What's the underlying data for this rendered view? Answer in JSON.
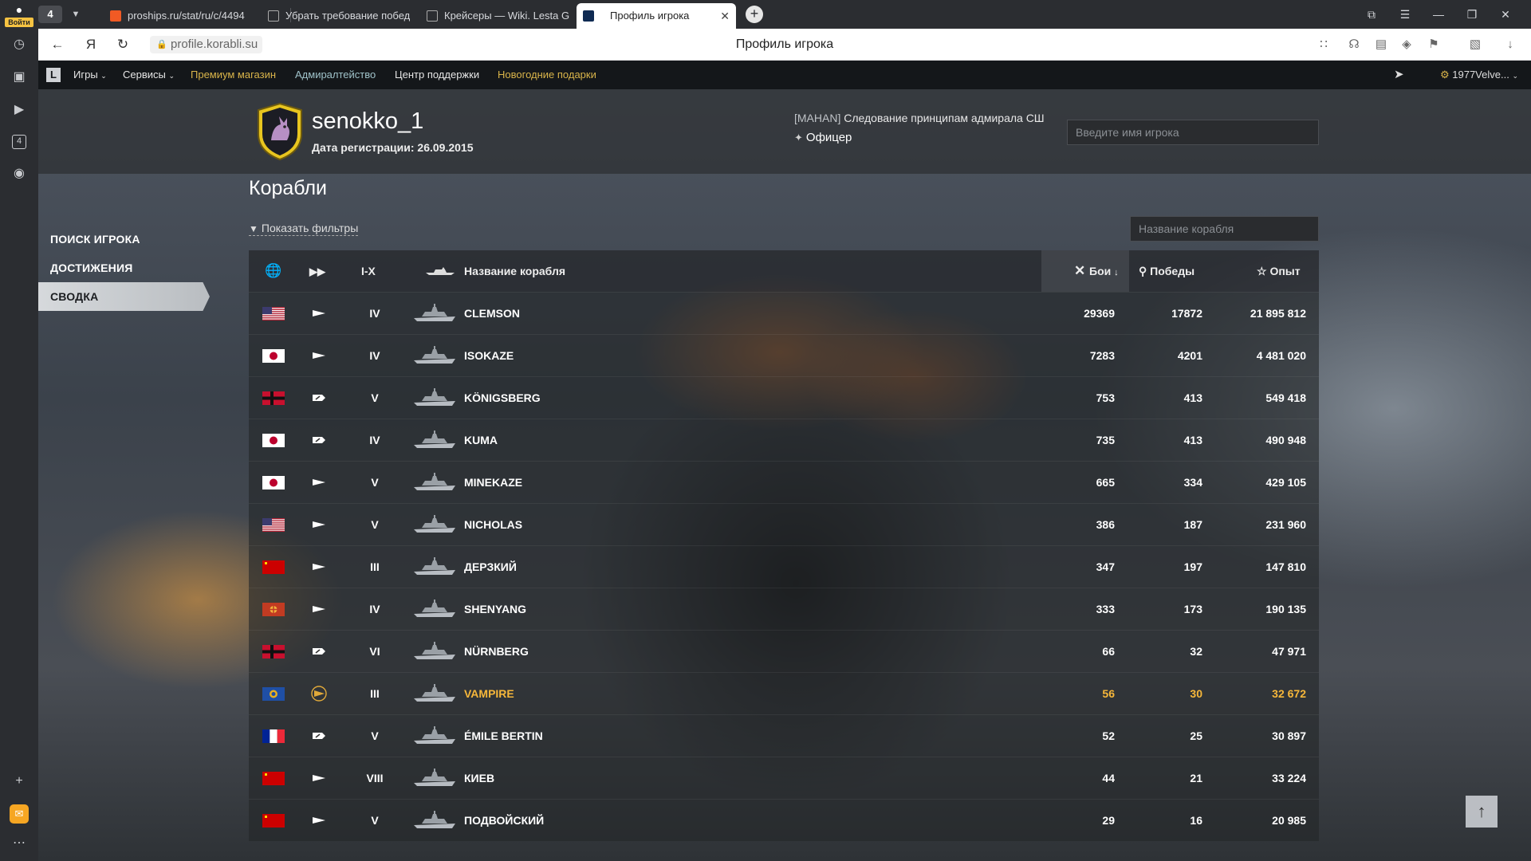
{
  "rail": {
    "login_label": "Войти",
    "tab_counter": "4"
  },
  "tabs": {
    "count": "4",
    "items": [
      {
        "title": "proships.ru/stat/ru/c/4494",
        "color": "#f15a24"
      },
      {
        "title": "Убрать требование побед",
        "color": "#3b3b3b"
      },
      {
        "title": "Крейсеры — Wiki. Lesta G",
        "color": "#3b3b3b"
      },
      {
        "title": "Профиль игрока",
        "color": "#0f2a52"
      }
    ]
  },
  "address": {
    "url": "profile.korabli.su",
    "page_title": "Профиль игрока"
  },
  "sitenav": {
    "logo": "L",
    "items": [
      {
        "label": "Игры",
        "color": "#e6e6e6",
        "dropdown": true
      },
      {
        "label": "Сервисы",
        "color": "#e6e6e6",
        "dropdown": true
      },
      {
        "label": "Премиум магазин",
        "color": "#d9b44a"
      },
      {
        "label": "Адмиралтейство",
        "color": "#9fc2c9"
      },
      {
        "label": "Центр поддержки",
        "color": "#e6e6e6"
      },
      {
        "label": "Новогодние подарки",
        "color": "#d9b44a"
      }
    ],
    "user": "1977Velve..."
  },
  "profile": {
    "name": "senokko_1",
    "registered": "Дата регистрации: 26.09.2015",
    "clan_tag": "[MAHAN]",
    "clan_name": " Следование принципам адмирала СШ",
    "rank": "Офицер",
    "search_placeholder": "Введите имя игрока"
  },
  "menu": {
    "items": [
      "ПОИСК ИГРОКА",
      "ДОСТИЖЕНИЯ",
      "СВОДКА"
    ],
    "active": 2
  },
  "ships": {
    "title": "Корабли",
    "filters_label": "Показать фильтры",
    "search_placeholder": "Название корабля",
    "headers": {
      "tier": "I-X",
      "name": "Название корабля",
      "battles": "Бои",
      "wins": "Победы",
      "xp": "Опыт"
    },
    "rows": [
      {
        "nation": "usa",
        "type": "destroyer",
        "tier": "IV",
        "name": "CLEMSON",
        "battles": "29369",
        "wins": "17872",
        "xp": "21 895 812"
      },
      {
        "nation": "japan",
        "type": "destroyer",
        "tier": "IV",
        "name": "ISOKAZE",
        "battles": "7283",
        "wins": "4201",
        "xp": "4 481 020"
      },
      {
        "nation": "germany",
        "type": "cruiser",
        "tier": "V",
        "name": "KÖNIGSBERG",
        "battles": "753",
        "wins": "413",
        "xp": "549 418"
      },
      {
        "nation": "japan",
        "type": "cruiser",
        "tier": "IV",
        "name": "KUMA",
        "battles": "735",
        "wins": "413",
        "xp": "490 948"
      },
      {
        "nation": "japan",
        "type": "destroyer",
        "tier": "V",
        "name": "MINEKAZE",
        "battles": "665",
        "wins": "334",
        "xp": "429 105"
      },
      {
        "nation": "usa",
        "type": "destroyer",
        "tier": "V",
        "name": "NICHOLAS",
        "battles": "386",
        "wins": "187",
        "xp": "231 960"
      },
      {
        "nation": "ussr",
        "type": "destroyer",
        "tier": "III",
        "name": "ДЕРЗКИЙ",
        "battles": "347",
        "wins": "197",
        "xp": "147 810"
      },
      {
        "nation": "pan_asia",
        "type": "destroyer",
        "tier": "IV",
        "name": "SHENYANG",
        "battles": "333",
        "wins": "173",
        "xp": "190 135"
      },
      {
        "nation": "germany",
        "type": "cruiser",
        "tier": "VI",
        "name": "NÜRNBERG",
        "battles": "66",
        "wins": "32",
        "xp": "47 971"
      },
      {
        "nation": "commonwealth",
        "type": "destroyer-premium",
        "tier": "III",
        "name": "VAMPIRE",
        "battles": "56",
        "wins": "30",
        "xp": "32 672",
        "premium": true
      },
      {
        "nation": "france",
        "type": "cruiser",
        "tier": "V",
        "name": "ÉMILE BERTIN",
        "battles": "52",
        "wins": "25",
        "xp": "30 897"
      },
      {
        "nation": "ussr",
        "type": "destroyer",
        "tier": "VIII",
        "name": "КИЕВ",
        "battles": "44",
        "wins": "21",
        "xp": "33 224"
      },
      {
        "nation": "ussr",
        "type": "destroyer",
        "tier": "V",
        "name": "ПОДВОЙСКИЙ",
        "battles": "29",
        "wins": "16",
        "xp": "20 985"
      }
    ]
  },
  "colors": {
    "premium_text": "#f6b73a",
    "gold_link": "#d9b44a"
  }
}
